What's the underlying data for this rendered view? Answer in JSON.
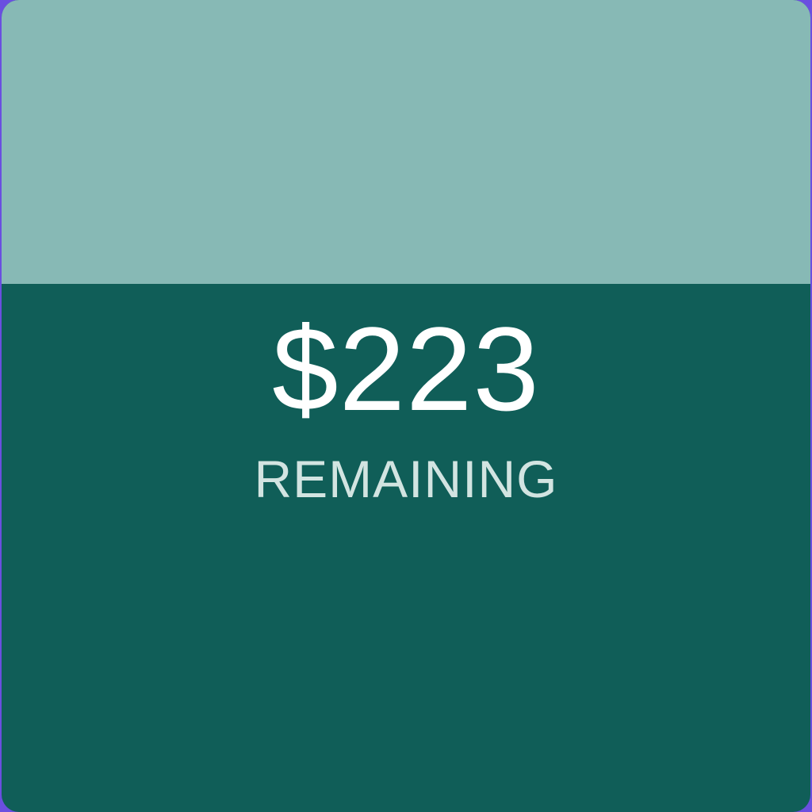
{
  "widget": {
    "amount": "$223",
    "label": "REMAINING",
    "remaining_fraction": 0.65,
    "colors": {
      "fill_remaining": "#105e58",
      "fill_spent": "#87b9b5",
      "amount_text": "#ffffff",
      "label_text": "#d2e4e1",
      "frame": "#6a4fe0"
    }
  }
}
